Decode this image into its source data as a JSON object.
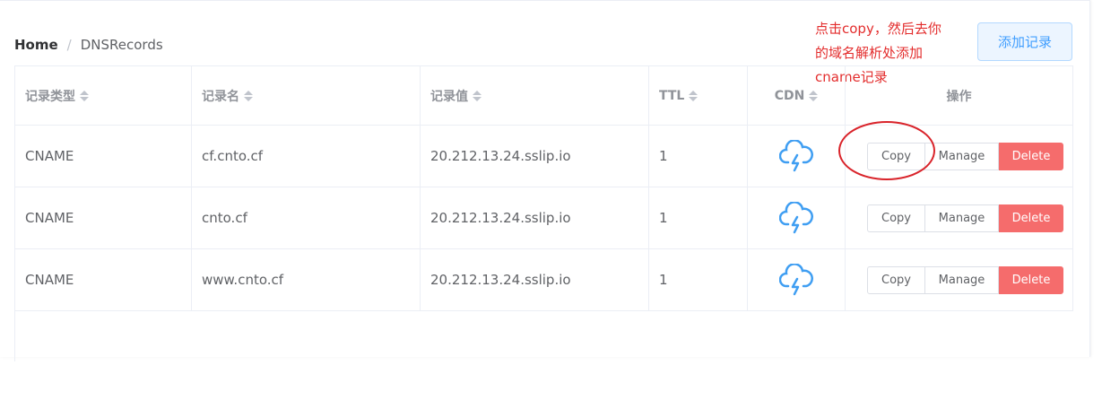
{
  "breadcrumb": {
    "home": "Home",
    "separator": "/",
    "current": "DNSRecords"
  },
  "annotation": {
    "line1": "点击copy，然后去你",
    "line2": "的域名解析处添加",
    "line3": "cname记录"
  },
  "add_button": {
    "label": "添加记录"
  },
  "table": {
    "columns": {
      "type": "记录类型",
      "name": "记录名",
      "value": "记录值",
      "ttl": "TTL",
      "cdn": "CDN",
      "actions": "操作"
    },
    "rows": [
      {
        "type": "CNAME",
        "name": "cf.cnto.cf",
        "value": "20.212.13.24.sslip.io",
        "ttl": "1"
      },
      {
        "type": "CNAME",
        "name": "cnto.cf",
        "value": "20.212.13.24.sslip.io",
        "ttl": "1"
      },
      {
        "type": "CNAME",
        "name": "www.cnto.cf",
        "value": "20.212.13.24.sslip.io",
        "ttl": "1"
      }
    ],
    "actions": {
      "copy": "Copy",
      "manage": "Manage",
      "delete": "Delete"
    }
  },
  "colors": {
    "accent": "#409eff",
    "delete": "#f56c6c",
    "annotation": "#e32c2c",
    "cdn_icon": "#3f9ef2"
  },
  "icons": {
    "cdn": "cloud-lightning-icon"
  }
}
